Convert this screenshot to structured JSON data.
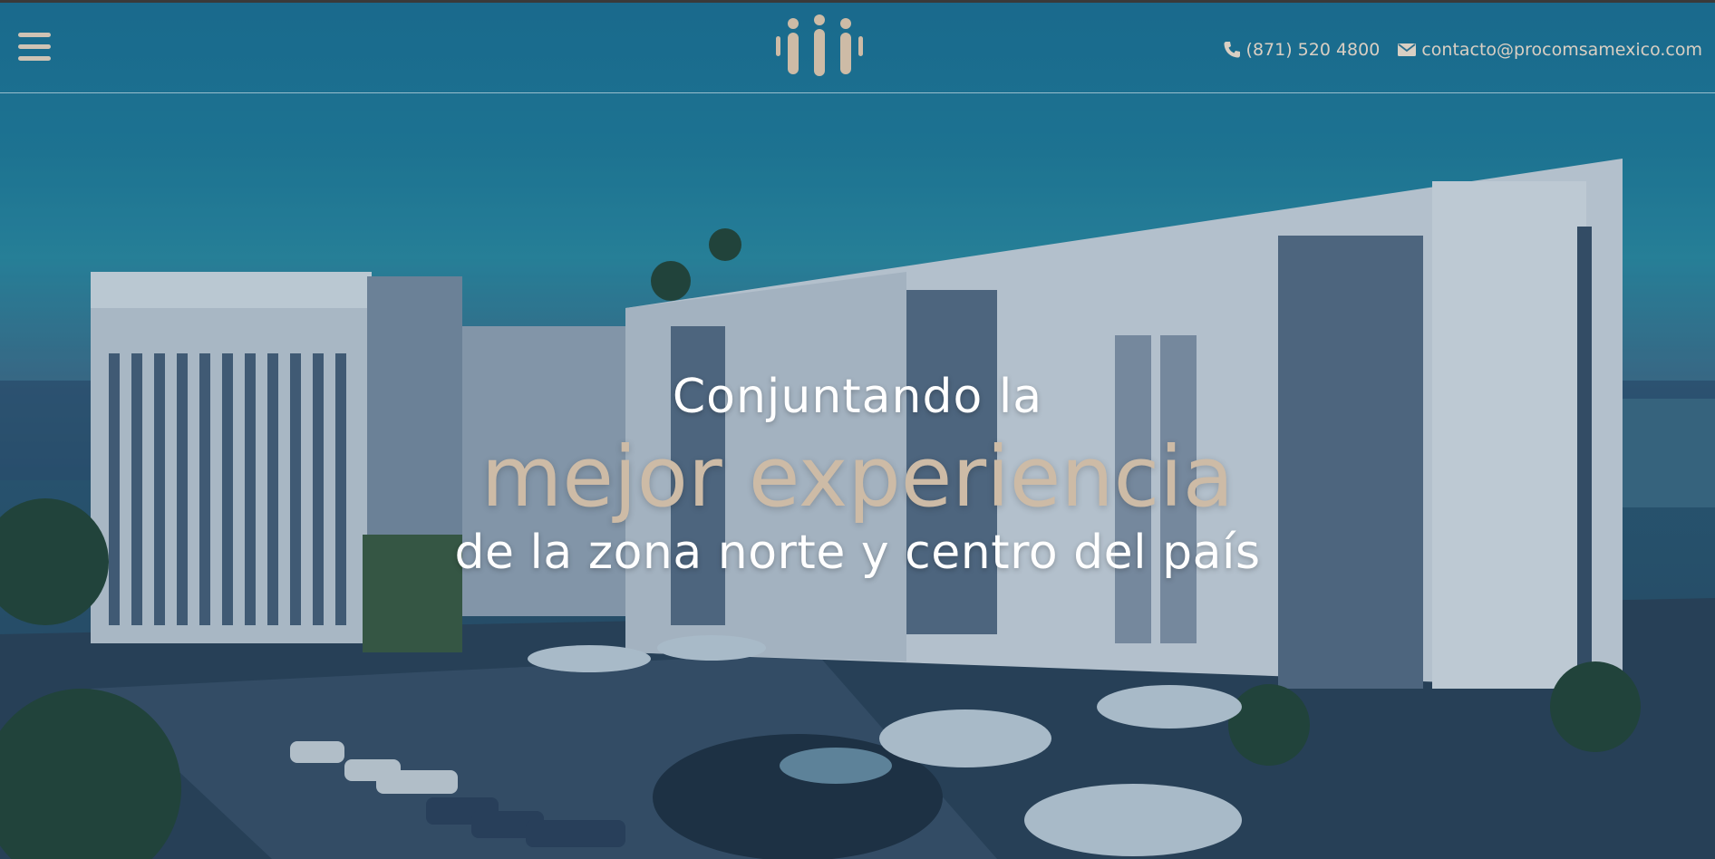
{
  "header": {
    "menu_icon": "hamburger-menu-icon",
    "logo_icon": "procomsa-people-logo-icon",
    "phone_icon": "phone-icon",
    "phone": "(871) 520 4800",
    "email_icon": "envelope-icon",
    "email": "contacto@procomsamexico.com"
  },
  "hero": {
    "line1": "Conjuntando la",
    "line2": "mejor experiencia",
    "line3": "de la zona norte y centro del país",
    "accent_color": "#cdbba6",
    "background_image": "building-complex-rendering"
  }
}
